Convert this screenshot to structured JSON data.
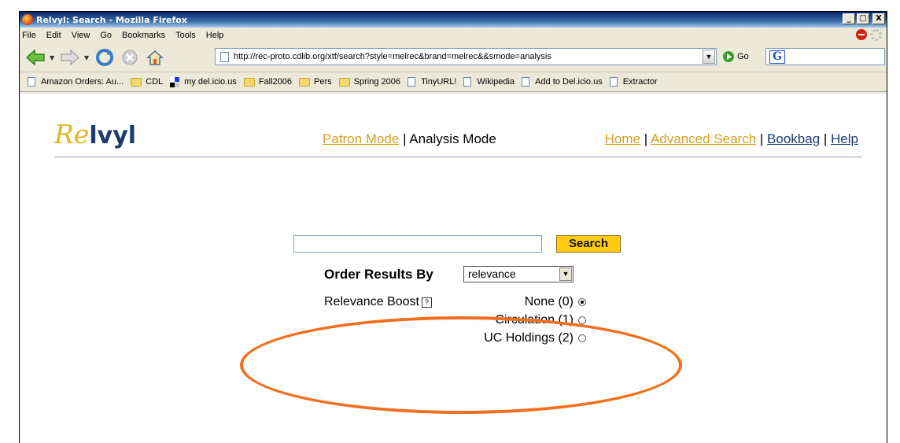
{
  "window": {
    "title": "Relvyl: Search - Mozilla Firefox",
    "min": "_",
    "max": "□",
    "close": "X"
  },
  "menu": [
    "File",
    "Edit",
    "View",
    "Go",
    "Bookmarks",
    "Tools",
    "Help"
  ],
  "nav": {
    "url": "http://rec-proto.cdlib.org/xtf/search?style=melrec&brand=melrec&&smode=analysis",
    "go_label": "Go",
    "search_engine_icon": "G"
  },
  "bookmarks": [
    {
      "icon": "page",
      "label": "Amazon Orders: Au..."
    },
    {
      "icon": "folder",
      "label": "CDL"
    },
    {
      "icon": "delicious",
      "label": "my del.icio.us"
    },
    {
      "icon": "folder",
      "label": "Fall2006"
    },
    {
      "icon": "folder",
      "label": "Pers"
    },
    {
      "icon": "folder",
      "label": "Spring 2006"
    },
    {
      "icon": "page",
      "label": "TinyURL!"
    },
    {
      "icon": "page",
      "label": "Wikipedia"
    },
    {
      "icon": "page",
      "label": "Add to Del.icio.us"
    },
    {
      "icon": "page",
      "label": "Extractor"
    }
  ],
  "page": {
    "logo_re": "Re",
    "logo_vyl": "lvyl",
    "modes": {
      "patron": "Patron Mode",
      "sep": " | ",
      "analysis": "Analysis Mode"
    },
    "links": {
      "home": "Home",
      "advanced": "Advanced Search",
      "bookbag": "Bookbag",
      "help": "Help",
      "sep": " | "
    },
    "search_value": "",
    "search_button": "Search",
    "order_label": "Order Results By",
    "order_value": "relevance",
    "boost_label": "Relevance Boost",
    "boost_help": "?",
    "boost_options": [
      {
        "label": "None (0)",
        "selected": true
      },
      {
        "label": "Circulation (1)",
        "selected": false
      },
      {
        "label": "UC Holdings (2)",
        "selected": false
      }
    ]
  },
  "colors": {
    "annotation_oval": "#f07020",
    "accent_link": "#d4a020",
    "brand_blue": "#1d3b72",
    "search_button": "#ffcc11"
  }
}
